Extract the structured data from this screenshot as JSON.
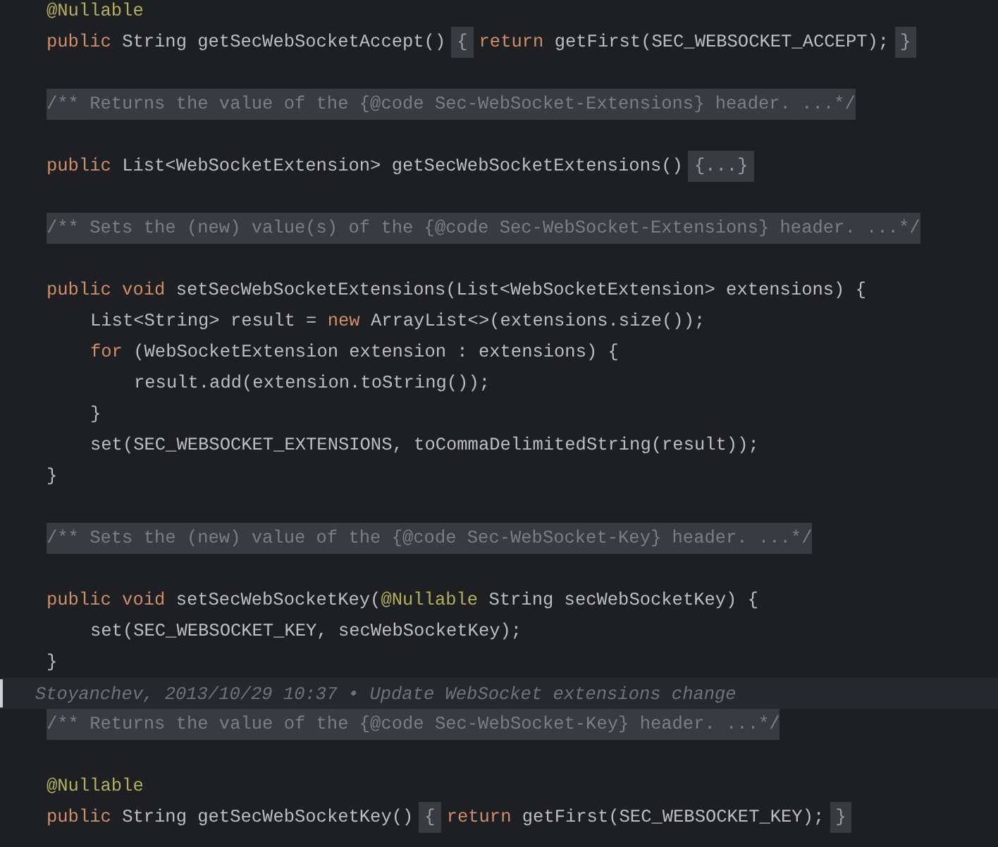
{
  "editor": {
    "lines": [
      {
        "kind": "code",
        "segments": [
          {
            "kind": "code",
            "tokens": [
              {
                "text": "@Nullable",
                "kind": "annotation"
              }
            ]
          }
        ]
      },
      {
        "kind": "code",
        "segments": [
          {
            "kind": "code",
            "tokens": [
              {
                "text": "public",
                "kind": "keyword"
              },
              {
                "text": " String getSecWebSocketAccept()",
                "kind": "plain"
              }
            ]
          },
          {
            "kind": "fold",
            "text": "{"
          },
          {
            "kind": "code",
            "tokens": [
              {
                "text": "return",
                "kind": "keyword"
              },
              {
                "text": " getFirst(SEC_WEBSOCKET_ACCEPT);",
                "kind": "plain"
              }
            ]
          },
          {
            "kind": "fold",
            "text": "}"
          }
        ]
      },
      {
        "kind": "blank"
      },
      {
        "kind": "code",
        "segments": [
          {
            "kind": "comment-fold",
            "text": "/** Returns the value of the {@code Sec-WebSocket-Extensions} header. ...*/"
          }
        ]
      },
      {
        "kind": "blank"
      },
      {
        "kind": "code",
        "segments": [
          {
            "kind": "code",
            "tokens": [
              {
                "text": "public",
                "kind": "keyword"
              },
              {
                "text": " List<WebSocketExtension> getSecWebSocketExtensions()",
                "kind": "plain"
              }
            ]
          },
          {
            "kind": "fold",
            "text": "{...}"
          }
        ]
      },
      {
        "kind": "blank"
      },
      {
        "kind": "code",
        "segments": [
          {
            "kind": "comment-fold",
            "text": "/** Sets the (new) value(s) of the {@code Sec-WebSocket-Extensions} header. ...*/"
          }
        ]
      },
      {
        "kind": "blank"
      },
      {
        "kind": "code",
        "segments": [
          {
            "kind": "code",
            "tokens": [
              {
                "text": "public void",
                "kind": "keyword"
              },
              {
                "text": " setSecWebSocketExtensions(List<WebSocketExtension> extensions) {",
                "kind": "plain"
              }
            ]
          }
        ],
        "children": [
          {
            "kind": "code",
            "segments": [
              {
                "kind": "code",
                "tokens": [
                  {
                    "text": "List<String> result = ",
                    "kind": "plain"
                  },
                  {
                    "text": "new",
                    "kind": "keyword"
                  },
                  {
                    "text": " ArrayList<>(extensions.size());",
                    "kind": "plain"
                  }
                ]
              }
            ]
          },
          {
            "kind": "code",
            "segments": [
              {
                "kind": "code",
                "tokens": [
                  {
                    "text": "for",
                    "kind": "keyword"
                  },
                  {
                    "text": " (WebSocketExtension extension : extensions) {",
                    "kind": "plain"
                  }
                ]
              }
            ],
            "children": [
              {
                "kind": "code",
                "segments": [
                  {
                    "kind": "code",
                    "tokens": [
                      {
                        "text": "result.add(extension.toString());",
                        "kind": "plain"
                      }
                    ]
                  }
                ]
              }
            ]
          },
          {
            "kind": "code",
            "segments": [
              {
                "kind": "code",
                "tokens": [
                  {
                    "text": "}",
                    "kind": "plain"
                  }
                ]
              }
            ]
          },
          {
            "kind": "code",
            "segments": [
              {
                "kind": "code",
                "tokens": [
                  {
                    "text": "set(SEC_WEBSOCKET_EXTENSIONS, toCommaDelimitedString(result));",
                    "kind": "plain"
                  }
                ]
              }
            ]
          }
        ]
      },
      {
        "kind": "code",
        "segments": [
          {
            "kind": "code",
            "tokens": [
              {
                "text": "}",
                "kind": "plain"
              }
            ]
          }
        ]
      },
      {
        "kind": "blank"
      },
      {
        "kind": "code",
        "segments": [
          {
            "kind": "comment-fold",
            "text": "/** Sets the (new) value of the {@code Sec-WebSocket-Key} header. ...*/"
          }
        ]
      },
      {
        "kind": "blank"
      },
      {
        "kind": "code",
        "segments": [
          {
            "kind": "code",
            "tokens": [
              {
                "text": "public void",
                "kind": "keyword"
              },
              {
                "text": " setSecWebSocketKey(",
                "kind": "plain"
              },
              {
                "text": "@Nullable",
                "kind": "annotation"
              },
              {
                "text": " String secWebSocketKey) {",
                "kind": "plain"
              }
            ]
          }
        ],
        "children": [
          {
            "kind": "code",
            "segments": [
              {
                "kind": "code",
                "tokens": [
                  {
                    "text": "set(SEC_WEBSOCKET_KEY, secWebSocketKey);",
                    "kind": "plain"
                  }
                ]
              }
            ]
          }
        ]
      },
      {
        "kind": "code",
        "segments": [
          {
            "kind": "code",
            "tokens": [
              {
                "text": "}",
                "kind": "plain"
              }
            ]
          }
        ]
      },
      {
        "kind": "blame",
        "text": "Stoyanchev, 2013/10/29 10:37 • Update WebSocket extensions change"
      },
      {
        "kind": "code",
        "segments": [
          {
            "kind": "comment-fold",
            "text": "/** Returns the value of the {@code Sec-WebSocket-Key} header. ...*/"
          }
        ]
      },
      {
        "kind": "blank"
      },
      {
        "kind": "code",
        "segments": [
          {
            "kind": "code",
            "tokens": [
              {
                "text": "@Nullable",
                "kind": "annotation"
              }
            ]
          }
        ]
      },
      {
        "kind": "code",
        "segments": [
          {
            "kind": "code",
            "tokens": [
              {
                "text": "public",
                "kind": "keyword"
              },
              {
                "text": " String getSecWebSocketKey()",
                "kind": "plain"
              }
            ]
          },
          {
            "kind": "fold",
            "text": "{"
          },
          {
            "kind": "code",
            "tokens": [
              {
                "text": "return",
                "kind": "keyword"
              },
              {
                "text": " getFirst(SEC_WEBSOCKET_KEY);",
                "kind": "plain"
              }
            ]
          },
          {
            "kind": "fold",
            "text": "}"
          }
        ]
      }
    ]
  }
}
